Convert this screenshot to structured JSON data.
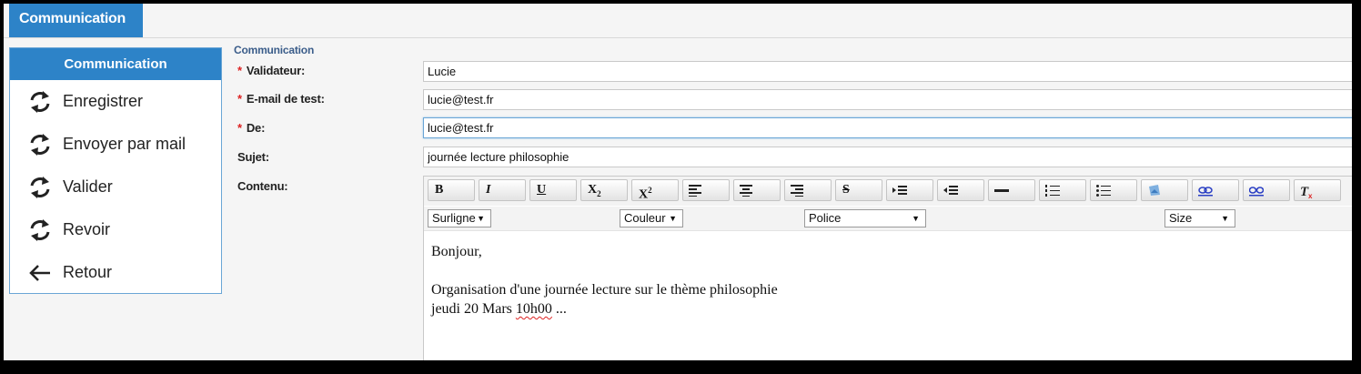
{
  "top_tab": {
    "label": "Communication"
  },
  "side_menu": {
    "header": "Communication",
    "items": [
      {
        "label": "Enregistrer",
        "icon": "refresh-icon"
      },
      {
        "label": "Envoyer par mail",
        "icon": "refresh-icon"
      },
      {
        "label": "Valider",
        "icon": "refresh-icon"
      },
      {
        "label": "Revoir",
        "icon": "refresh-icon"
      },
      {
        "label": "Retour",
        "icon": "arrow-left-icon"
      }
    ]
  },
  "form": {
    "legend": "Communication",
    "required_marker": "*",
    "fields": {
      "validateur": {
        "label": "Validateur:",
        "value": "Lucie"
      },
      "email_test": {
        "label": "E-mail de test:",
        "value": "lucie@test.fr"
      },
      "de": {
        "label": "De:",
        "value": "lucie@test.fr"
      },
      "sujet": {
        "label": "Sujet:",
        "value": "journée lecture philosophie"
      },
      "contenu": {
        "label": "Contenu:"
      }
    }
  },
  "editor": {
    "toolbar": {
      "bold": "B",
      "italic": "I",
      "underline": "U",
      "subscript": "X",
      "subscript_mark": "2",
      "superscript": "X",
      "superscript_mark": "2",
      "strike": "S"
    },
    "dropdowns": {
      "surligne": "Surligne",
      "couleur": "Couleur",
      "police": "Police",
      "size": "Size"
    },
    "content": {
      "line1": "Bonjour,",
      "line2": "Organisation d'une journée lecture sur le thème philosophie",
      "line3_pre": "jeudi 20 Mars ",
      "line3_spell": "10h00",
      "line3_post": " ..."
    }
  },
  "colors": {
    "accent": "#2d83c8",
    "required": "#dd2222",
    "legend": "#3b5d8a"
  }
}
